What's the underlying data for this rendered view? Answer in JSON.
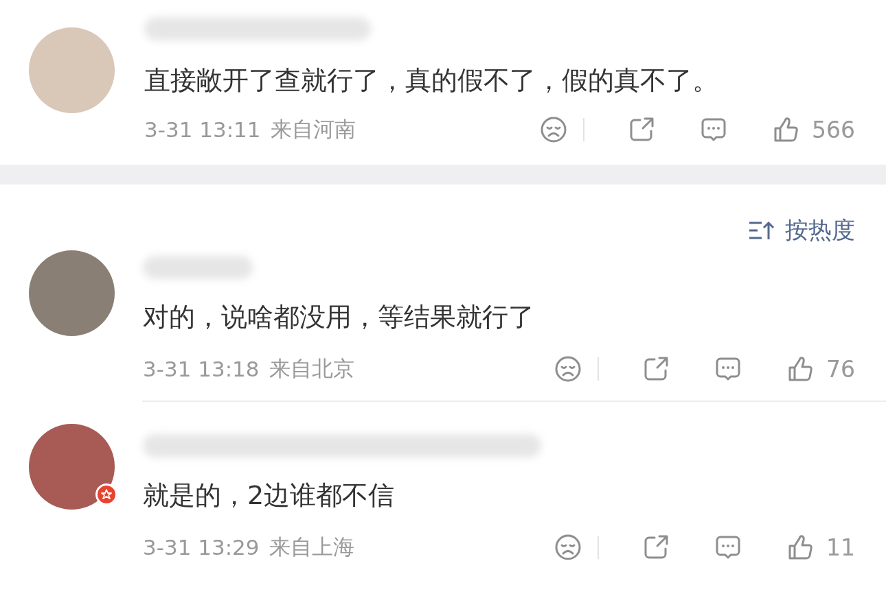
{
  "comments": [
    {
      "text": "直接敞开了查就行了，真的假不了，假的真不了。",
      "time": "3-31 13:11",
      "location": "来自河南",
      "likes": "566",
      "verified": false
    },
    {
      "text": "对的，说啥都没用，等结果就行了",
      "time": "3-31 13:18",
      "location": "来自北京",
      "likes": "76",
      "verified": false
    },
    {
      "text": "就是的，2边谁都不信",
      "time": "3-31 13:29",
      "location": "来自上海",
      "likes": "11",
      "verified": true
    }
  ],
  "sort": {
    "label": "按热度"
  }
}
